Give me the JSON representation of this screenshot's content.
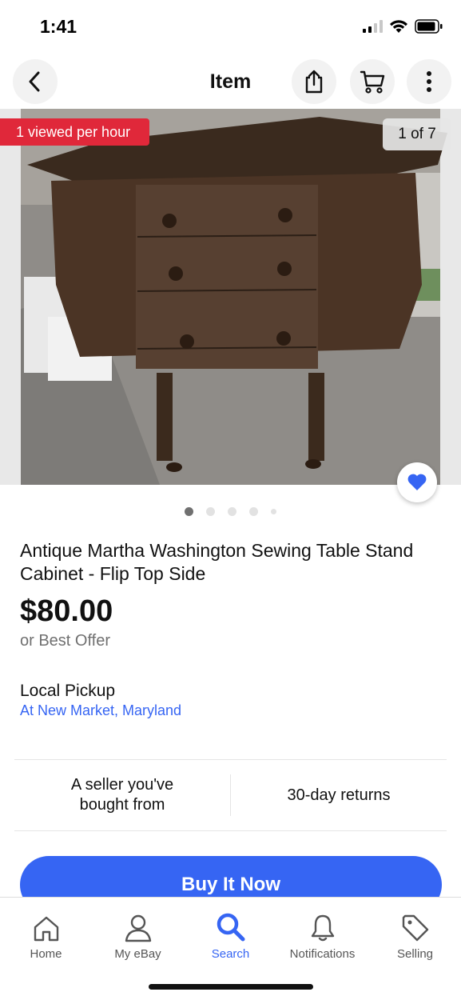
{
  "status": {
    "time": "1:41"
  },
  "header": {
    "title": "Item"
  },
  "photo": {
    "views_badge": "1 viewed per hour",
    "counter": "1 of 7",
    "dot_count": 5,
    "active_dot": 0
  },
  "item": {
    "title": "Antique Martha Washington Sewing Table Stand Cabinet - Flip Top Side",
    "price": "$80.00",
    "offer": "or Best Offer",
    "pickup_label": "Local Pickup",
    "pickup_location": "At New Market, Maryland"
  },
  "info": {
    "seller": "A seller you've bought from",
    "returns": "30-day returns"
  },
  "buy": {
    "label": "Buy It Now"
  },
  "tabs": [
    {
      "label": "Home",
      "icon": "home-icon"
    },
    {
      "label": "My eBay",
      "icon": "person-icon"
    },
    {
      "label": "Search",
      "icon": "search-icon",
      "active": true
    },
    {
      "label": "Notifications",
      "icon": "bell-icon"
    },
    {
      "label": "Selling",
      "icon": "tag-icon"
    }
  ],
  "colors": {
    "accent": "#3665f3",
    "badge_red": "#e0283a"
  }
}
